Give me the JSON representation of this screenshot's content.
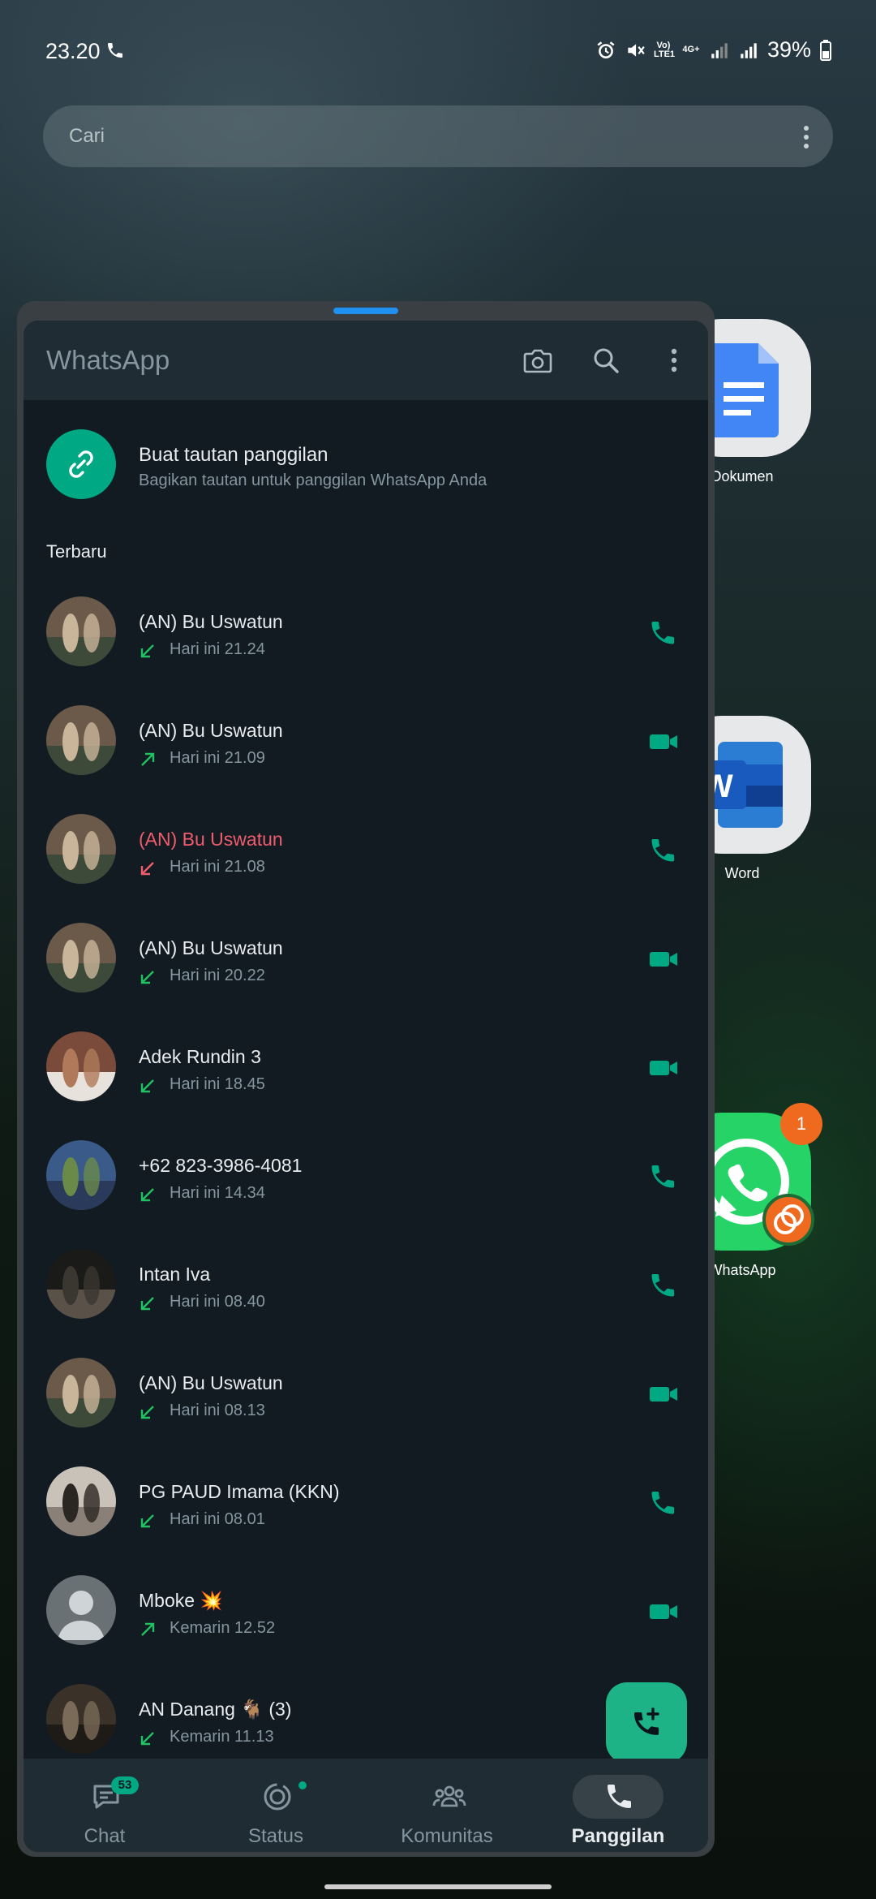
{
  "status_bar": {
    "time": "23.20",
    "signal_label": "Vo) LTE1",
    "network_label": "4G+",
    "battery": "39%"
  },
  "search": {
    "placeholder": "Cari"
  },
  "home_apps": [
    {
      "label": "Dokumen",
      "icon": "docs-icon",
      "color": "#4285f4"
    },
    {
      "label": "Word",
      "icon": "word-icon",
      "color": "#2b579a"
    },
    {
      "label": "WhatsApp",
      "icon": "whatsapp-icon",
      "color": "#25d366",
      "badge": "1"
    }
  ],
  "app": {
    "title": "WhatsApp",
    "link_title": "Buat tautan panggilan",
    "link_subtitle": "Bagikan tautan untuk panggilan WhatsApp Anda",
    "section_recent": "Terbaru"
  },
  "calls": [
    {
      "name": "(AN) Bu Uswatun",
      "time": "Hari ini 21.24",
      "direction": "incoming",
      "type": "voice",
      "missed": false
    },
    {
      "name": "(AN) Bu Uswatun",
      "time": "Hari ini 21.09",
      "direction": "outgoing",
      "type": "video",
      "missed": false
    },
    {
      "name": "(AN) Bu Uswatun",
      "time": "Hari ini 21.08",
      "direction": "missed",
      "type": "voice",
      "missed": true
    },
    {
      "name": "(AN) Bu Uswatun",
      "time": "Hari ini 20.22",
      "direction": "incoming",
      "type": "video",
      "missed": false
    },
    {
      "name": "Adek Rundin 3",
      "time": "Hari ini 18.45",
      "direction": "incoming",
      "type": "video",
      "missed": false
    },
    {
      "name": "+62 823-3986-4081",
      "time": "Hari ini 14.34",
      "direction": "incoming",
      "type": "voice",
      "missed": false
    },
    {
      "name": "Intan Iva",
      "time": "Hari ini 08.40",
      "direction": "incoming",
      "type": "voice",
      "missed": false
    },
    {
      "name": "(AN) Bu Uswatun",
      "time": "Hari ini 08.13",
      "direction": "incoming",
      "type": "video",
      "missed": false
    },
    {
      "name": "PG PAUD Imama (KKN)",
      "time": "Hari ini 08.01",
      "direction": "incoming",
      "type": "voice",
      "missed": false
    },
    {
      "name": "Mboke 💥",
      "time": "Kemarin 12.52",
      "direction": "outgoing",
      "type": "video",
      "missed": false
    },
    {
      "name": "AN Danang 🐐 (3)",
      "time": "Kemarin 11.13",
      "direction": "incoming",
      "type": "voice",
      "missed": false
    }
  ],
  "nav": {
    "chat": "Chat",
    "chat_badge": "53",
    "status": "Status",
    "communities": "Komunitas",
    "calls": "Panggilan"
  },
  "colors": {
    "accent": "#00a884",
    "missed": "#f15c6d",
    "background": "#111b21"
  }
}
